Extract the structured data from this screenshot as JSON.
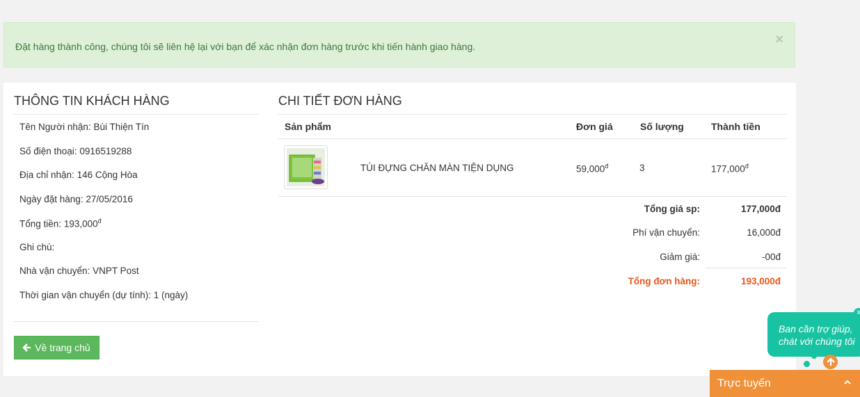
{
  "alert": {
    "message": "Đặt hàng thành công, chúng tôi sẽ liên hệ lại với bạn để xác nhận đơn hàng trước khi tiến hành giao hàng.",
    "close_label": "×"
  },
  "customer": {
    "title": "THÔNG TIN KHÁCH HÀNG",
    "fields": [
      {
        "label": "Tên Người nhận:",
        "value": "Bùi Thiện Tín"
      },
      {
        "label": "Số điện thoại:",
        "value": "0916519288"
      },
      {
        "label": "Địa chỉ nhận:",
        "value": "146 Cộng Hòa"
      },
      {
        "label": "Ngày đặt hàng:",
        "value": "27/05/2016"
      },
      {
        "label": "Tổng tiền:",
        "value": "193,000",
        "sup": "đ"
      },
      {
        "label": "Ghi chú:",
        "value": ""
      },
      {
        "label": "Nhà vận chuyển:",
        "value": "VNPT Post"
      },
      {
        "label": "Thời gian vận chuyển (dự tính):",
        "value": "1 (ngày)"
      }
    ],
    "home_button": "Về trang chủ"
  },
  "order": {
    "title": "CHI TIẾT ĐƠN HÀNG",
    "columns": [
      "Sản phẩm",
      "Đơn giá",
      "Số lượng",
      "Thành tiền"
    ],
    "items": [
      {
        "name": "TÚI ĐỰNG CHĂN MÀN TIỆN DỤNG",
        "price": "59,000",
        "qty": "3",
        "total": "177,000",
        "currency_sup": "đ"
      }
    ],
    "summary": {
      "subtotal_label": "Tổng giá sp:",
      "subtotal": "177,000đ",
      "shipping_label": "Phí vận chuyển:",
      "shipping": "16,000đ",
      "discount_label": "Giảm giá:",
      "discount": "-00đ",
      "total_label": "Tổng đơn hàng:",
      "total": "193,000đ"
    }
  },
  "chat": {
    "bubble_line1": "Ban cần trợ giúp,",
    "bubble_line2": "chát với chúng tôi",
    "close_label": "x",
    "online_label": "Trực tuyến",
    "accent": "#17c3a3",
    "bar_color": "#f0913a"
  }
}
